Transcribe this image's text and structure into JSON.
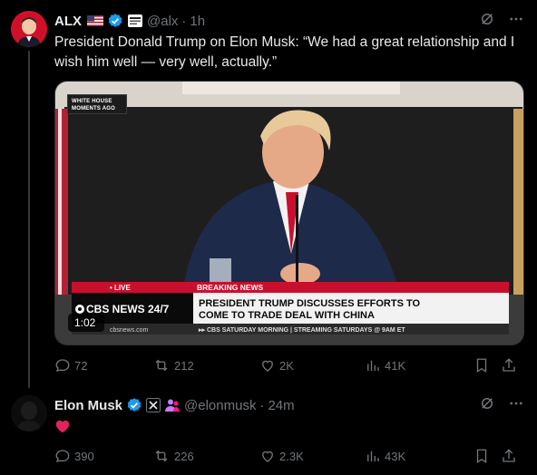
{
  "tweet1": {
    "name": "ALX",
    "flag": "🇺🇸",
    "handle": "@alx",
    "time": "1h",
    "text": "President Donald Trump on Elon Musk: “We had a great relationship and I wish him well — very well, actually.”",
    "media": {
      "overlay_label_line1": "WHITE HOUSE",
      "overlay_label_line2": "MOMENTS AGO",
      "live_label": "• LIVE",
      "network": "CBS NEWS 24/7",
      "breaking_label": "BREAKING NEWS",
      "headline_line1": "PRESIDENT TRUMP DISCUSSES EFFORTS TO",
      "headline_line2": "COME TO TRADE DEAL WITH CHINA",
      "website": "cbsnews.com",
      "ticker": "▸▸ CBS SATURDAY MORNING | STREAMING SATURDAYS @ 9AM ET",
      "duration": "1:02"
    },
    "stats": {
      "replies": "72",
      "reposts": "212",
      "likes": "2K",
      "views": "41K"
    }
  },
  "tweet2": {
    "name": "Elon Musk",
    "handle": "@elonmusk",
    "time": "24m",
    "text": "❤️",
    "stats": {
      "replies": "390",
      "reposts": "226",
      "likes": "2.3K",
      "views": "43K"
    }
  },
  "colors": {
    "background": "#000000",
    "verified": "#1d9bf0",
    "muted": "#71767b",
    "breaking_red": "#c8102e",
    "heart": "#f91880"
  }
}
